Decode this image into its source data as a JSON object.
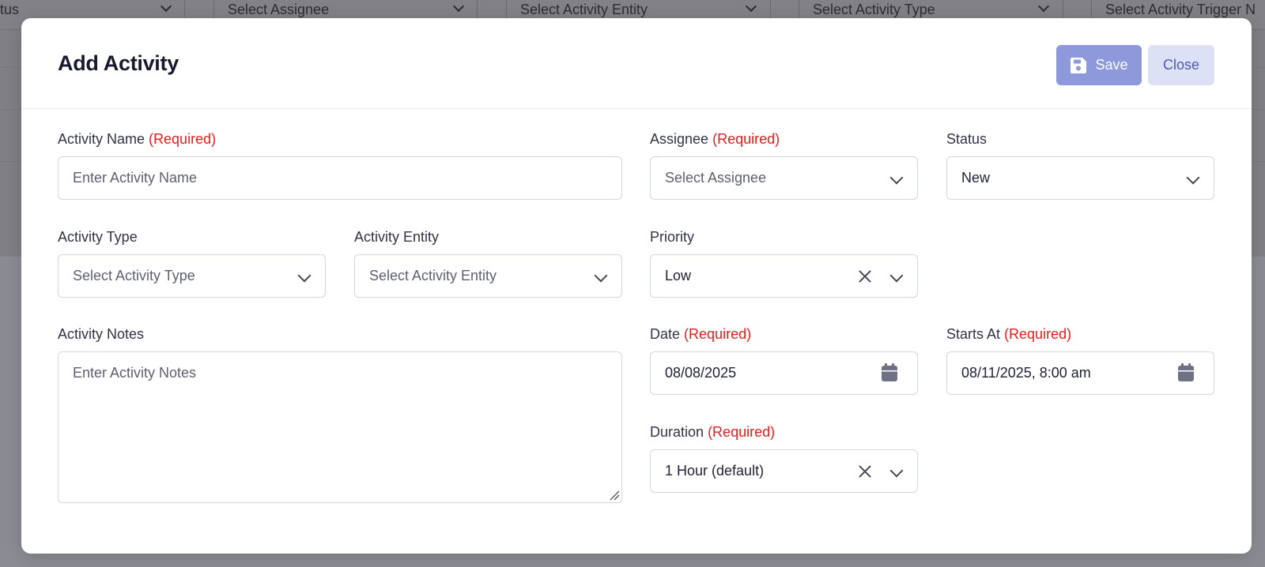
{
  "background": {
    "filters": [
      {
        "label": "tus"
      },
      {
        "label": "Select Assignee"
      },
      {
        "label": "Select Activity Entity"
      },
      {
        "label": "Select Activity Type"
      },
      {
        "label": "Select Activity Trigger N"
      }
    ]
  },
  "modal": {
    "title": "Add Activity",
    "save_label": "Save",
    "close_label": "Close"
  },
  "form": {
    "required_suffix": "(Required)",
    "activity_name": {
      "label": "Activity Name",
      "placeholder": "Enter Activity Name",
      "value": ""
    },
    "assignee": {
      "label": "Assignee",
      "placeholder": "Select Assignee"
    },
    "status": {
      "label": "Status",
      "value": "New"
    },
    "activity_type": {
      "label": "Activity Type",
      "placeholder": "Select Activity Type"
    },
    "activity_entity": {
      "label": "Activity Entity",
      "placeholder": "Select Activity Entity"
    },
    "priority": {
      "label": "Priority",
      "value": "Low"
    },
    "activity_notes": {
      "label": "Activity Notes",
      "placeholder": "Enter Activity Notes"
    },
    "date": {
      "label": "Date",
      "value": "08/08/2025"
    },
    "starts_at": {
      "label": "Starts At",
      "value": "08/11/2025, 8:00 am"
    },
    "duration": {
      "label": "Duration",
      "value": "1 Hour (default)"
    }
  },
  "colors": {
    "accent": "#8e99dc",
    "required": "#ee1b1b",
    "close_bg": "#dde1f5"
  },
  "icons": {
    "save": "floppy-disk-icon",
    "calendar": "calendar-icon",
    "chevron": "chevron-down-icon",
    "clear": "close-icon"
  }
}
